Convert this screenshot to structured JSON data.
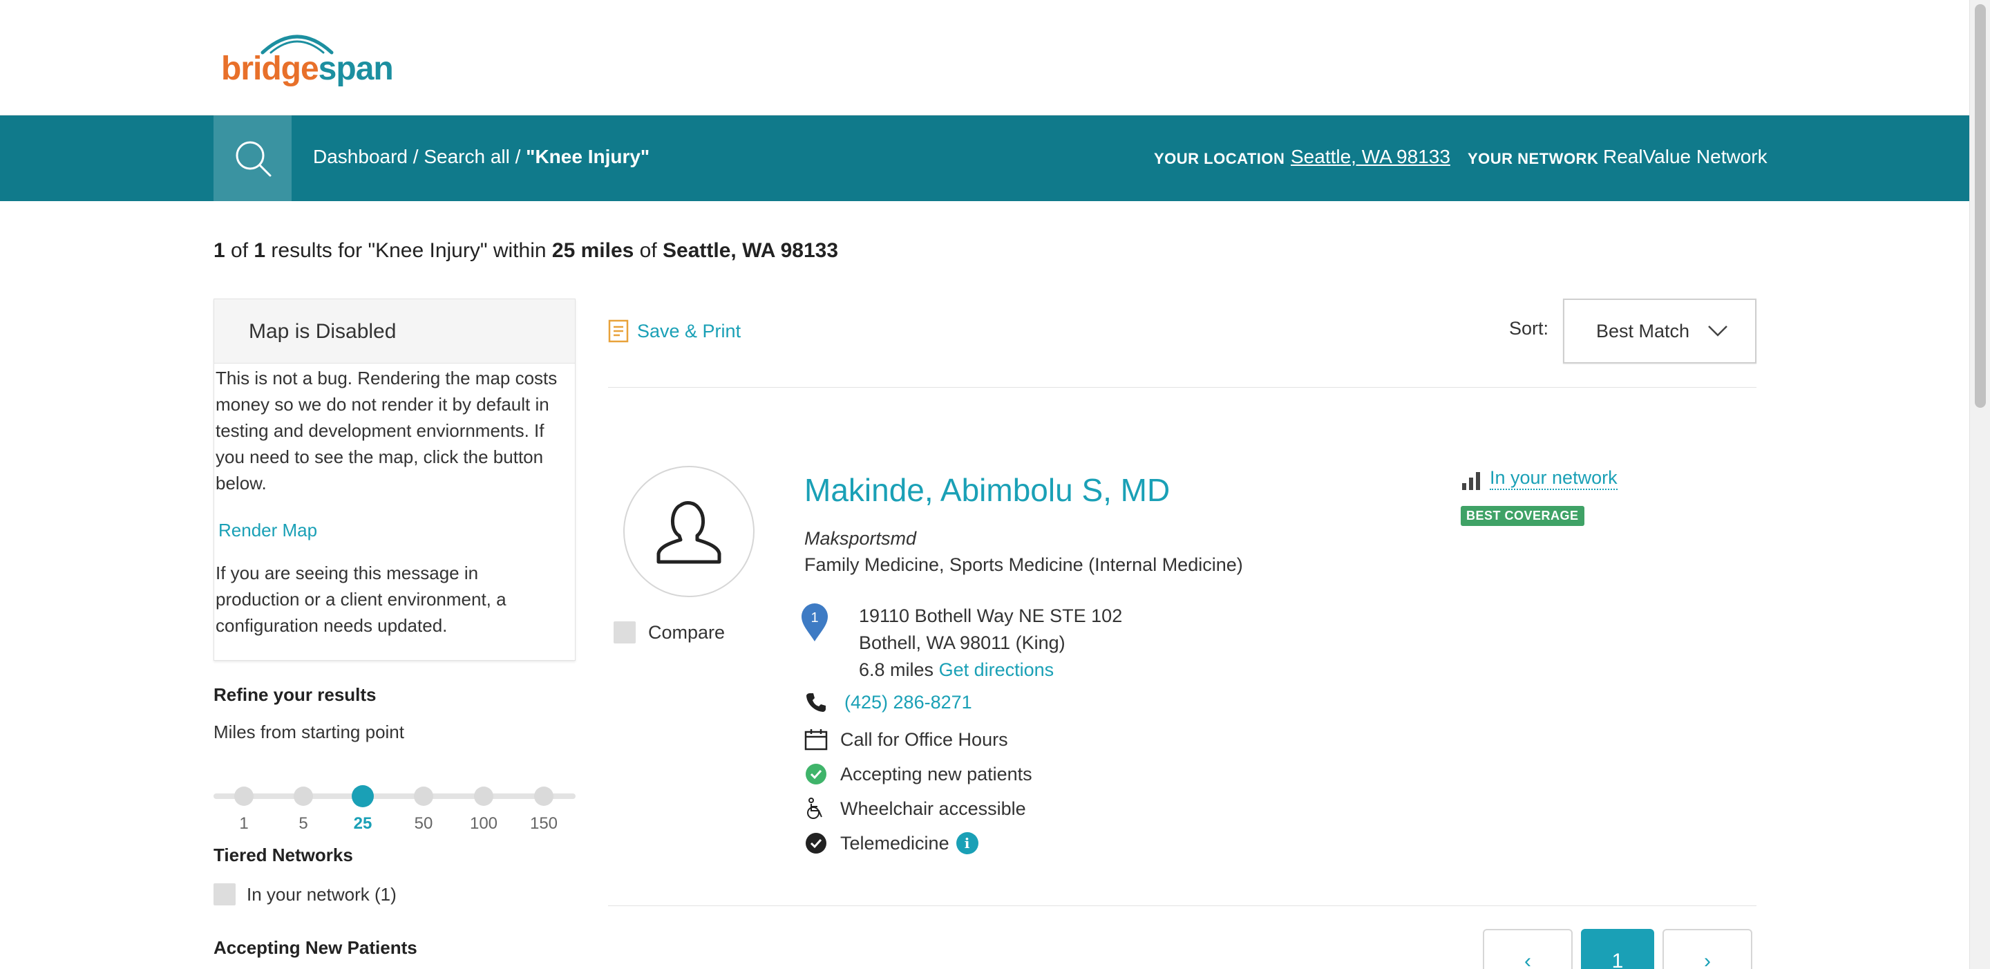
{
  "header": {
    "logo_part1": "bridge",
    "logo_part2": "span"
  },
  "navbar": {
    "breadcrumb_prefix": "Dashboard / Search all / ",
    "breadcrumb_current": "\"Knee Injury\"",
    "location_label": "YOUR LOCATION",
    "location_value": "Seattle, WA 98133",
    "network_label": "YOUR NETWORK",
    "network_value": "RealValue Network",
    "bar_color": "#107a8b"
  },
  "summary": {
    "count": "1",
    "of": " of ",
    "total": "1",
    "text_mid": " results for \"Knee Injury\" within ",
    "miles": "25 miles",
    "text_of": " of ",
    "location": "Seattle, WA 98133"
  },
  "map_panel": {
    "title": "Map is Disabled",
    "message": "This is not a bug. Rendering the map costs money so we do not render it by default in testing and development enviornments. If you need to see the map, click the button below.",
    "render_link": "Render Map",
    "footer": "If you are seeing this message in production or a client environment, a configuration needs updated."
  },
  "refine": {
    "title": "Refine your results",
    "miles_label": "Miles from starting point",
    "stops": [
      "1",
      "5",
      "25",
      "50",
      "100",
      "150"
    ],
    "selected": "25",
    "tiered_title": "Tiered Networks",
    "tier_option": "In your network (1)",
    "accepting_title": "Accepting New Patients"
  },
  "toolbar": {
    "save_print": "Save & Print",
    "sort_label": "Sort:",
    "sort_value": "Best Match"
  },
  "result": {
    "name": "Makinde, Abimbolu S, MD",
    "practice": "Maksportsmd",
    "specialty": "Family Medicine, Sports Medicine (Internal Medicine)",
    "pin_number": "1",
    "address_line1": "19110 Bothell Way NE STE 102",
    "address_line2": "Bothell, WA 98011 (King)",
    "distance": "6.8 miles",
    "directions": "Get directions",
    "phone": "(425) 286-8271",
    "hours": "Call for Office Hours",
    "accepting": "Accepting new patients",
    "wheelchair": "Wheelchair accessible",
    "telemedicine": "Telemedicine",
    "info_glyph": "i",
    "compare": "Compare",
    "network_link": "In your network",
    "coverage_badge": "BEST COVERAGE"
  },
  "pagination": {
    "prev": "‹",
    "current": "1",
    "next": "›"
  },
  "colors": {
    "accent": "#1aa0b6",
    "badge_green": "#3fa266",
    "logo_orange": "#e8702a"
  },
  "icons": [
    "search-icon",
    "document-icon",
    "chevron-down-icon",
    "person-icon",
    "map-pin-icon",
    "phone-icon",
    "calendar-icon",
    "check-circle-icon",
    "wheelchair-icon",
    "info-icon",
    "signal-bars-icon"
  ]
}
